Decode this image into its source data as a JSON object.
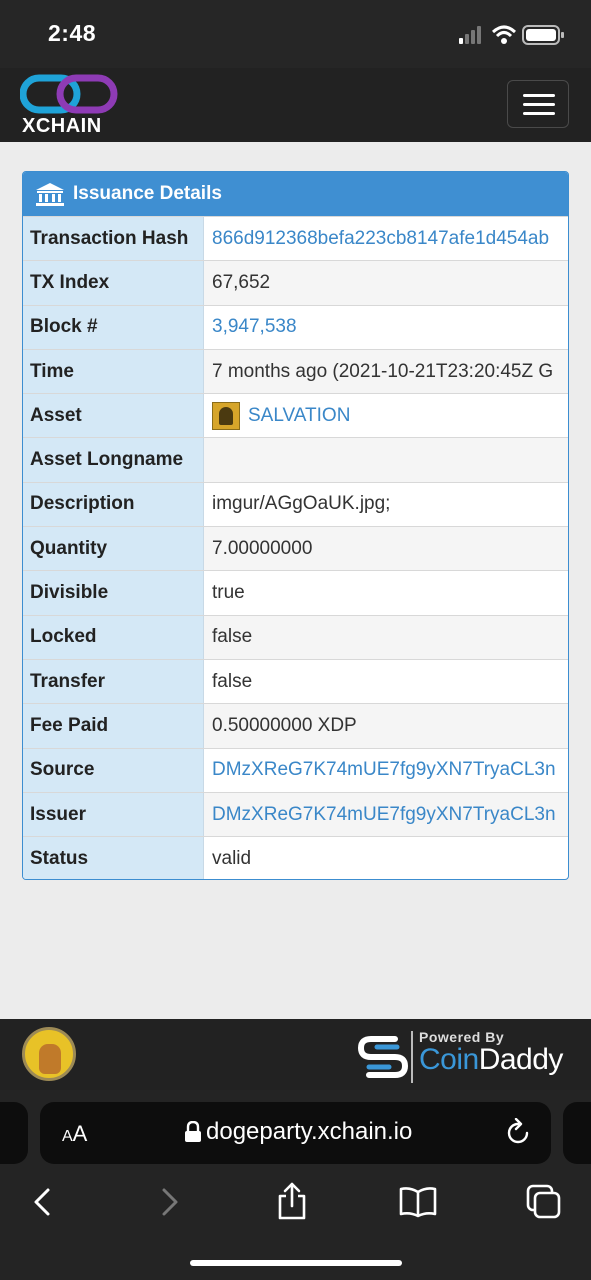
{
  "status_bar": {
    "time": "2:48"
  },
  "header": {
    "logo_text": "XCHAIN",
    "menu_icon": "hamburger-menu-icon"
  },
  "panel": {
    "title": "Issuance Details",
    "title_icon": "bank-icon",
    "rows": [
      {
        "key": "Transaction Hash",
        "value": "866d912368befa223cb8147afe1d454ab",
        "link": true
      },
      {
        "key": "TX Index",
        "value": "67,652",
        "link": false
      },
      {
        "key": "Block #",
        "value": "3,947,538",
        "link": true
      },
      {
        "key": "Time",
        "value": "7 months ago (2021-10-21T23:20:45Z G",
        "link": false
      },
      {
        "key": "Asset",
        "value": "SALVATION",
        "link": true
      },
      {
        "key": "Asset Longname",
        "value": "",
        "link": false
      },
      {
        "key": "Description",
        "value": "imgur/AGgOaUK.jpg;",
        "link": false
      },
      {
        "key": "Quantity",
        "value": "7.00000000",
        "link": false
      },
      {
        "key": "Divisible",
        "value": "true",
        "link": false
      },
      {
        "key": "Locked",
        "value": "false",
        "link": false
      },
      {
        "key": "Transfer",
        "value": "false",
        "link": false
      },
      {
        "key": "Fee Paid",
        "value": "0.50000000 XDP",
        "link": false
      },
      {
        "key": "Source",
        "value": "DMzXReG7K74mUE7fg9yXN7TryaCL3n",
        "link": true
      },
      {
        "key": "Issuer",
        "value": "DMzXReG7K74mUE7fg9yXN7TryaCL3n",
        "link": true
      },
      {
        "key": "Status",
        "value": "valid",
        "link": false
      }
    ]
  },
  "footer": {
    "powered_by": "Powered By",
    "brand_a": "Coin",
    "brand_b": "Daddy"
  },
  "browser": {
    "text_size": "AA",
    "url": "dogeparty.xchain.io",
    "lock_icon": "lock-icon",
    "reload_icon": "reload-icon"
  },
  "colors": {
    "accent": "#3f8fd2",
    "link": "#3a87c8",
    "key_bg": "#d4e8f6"
  }
}
